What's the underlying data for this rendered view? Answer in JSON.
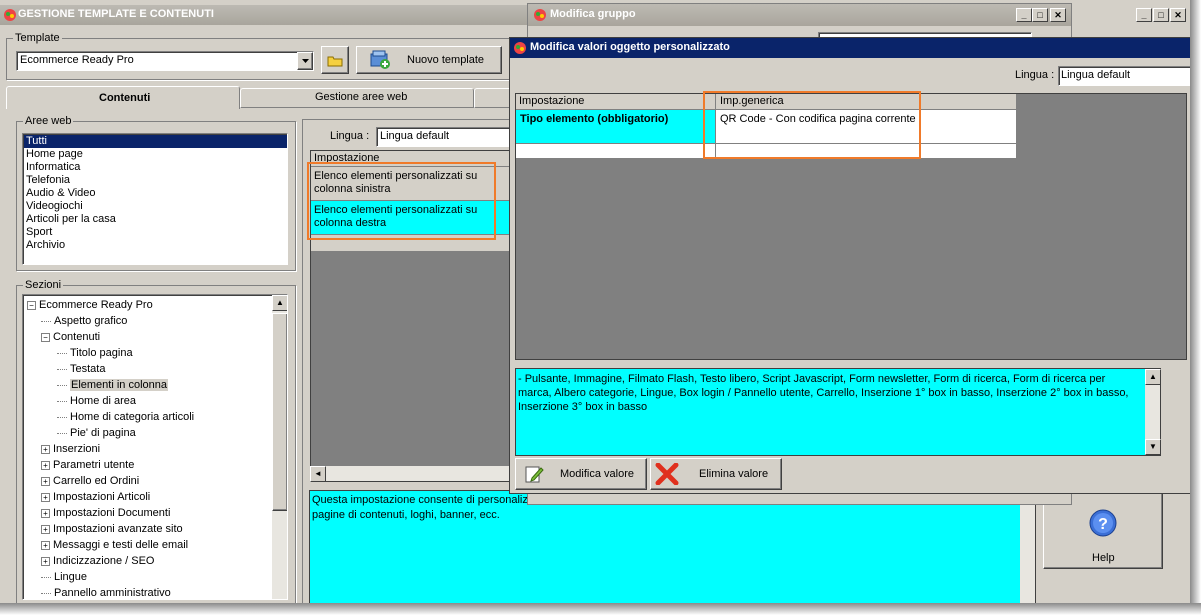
{
  "main_window": {
    "title": "GESTIONE TEMPLATE E CONTENUTI",
    "template_label": "Template",
    "template_value": "Ecommerce Ready Pro",
    "new_template_label": "Nuovo template",
    "tabs": [
      {
        "label": "Contenuti",
        "active": true
      },
      {
        "label": "Gestione aree web",
        "active": false
      }
    ],
    "aree_web_label": "Aree web",
    "aree_web": [
      "Tutti",
      "Home page",
      "Informatica",
      "Telefonia",
      "Audio & Video",
      "Videogiochi",
      "Articoli per la casa",
      "Sport",
      "Archivio"
    ],
    "sezioni_label": "Sezioni",
    "tree": [
      {
        "label": "Ecommerce Ready Pro",
        "level": 0,
        "toggle": "minus"
      },
      {
        "label": "Aspetto grafico",
        "level": 1,
        "toggle": ""
      },
      {
        "label": "Contenuti",
        "level": 1,
        "toggle": "minus"
      },
      {
        "label": "Titolo pagina",
        "level": 2,
        "toggle": ""
      },
      {
        "label": "Testata",
        "level": 2,
        "toggle": ""
      },
      {
        "label": "Elementi in colonna",
        "level": 2,
        "toggle": "",
        "selected": true
      },
      {
        "label": "Home di area",
        "level": 2,
        "toggle": ""
      },
      {
        "label": "Home di categoria articoli",
        "level": 2,
        "toggle": ""
      },
      {
        "label": "Pie' di pagina",
        "level": 2,
        "toggle": ""
      },
      {
        "label": "Inserzioni",
        "level": 1,
        "toggle": "plus"
      },
      {
        "label": "Parametri utente",
        "level": 1,
        "toggle": "plus"
      },
      {
        "label": "Carrello ed Ordini",
        "level": 1,
        "toggle": "plus"
      },
      {
        "label": "Impostazioni Articoli",
        "level": 1,
        "toggle": "plus"
      },
      {
        "label": "Impostazioni Documenti",
        "level": 1,
        "toggle": "plus"
      },
      {
        "label": "Impostazioni avanzate sito",
        "level": 1,
        "toggle": "plus"
      },
      {
        "label": "Messaggi e testi delle email",
        "level": 1,
        "toggle": "plus"
      },
      {
        "label": "Indicizzazione / SEO",
        "level": 1,
        "toggle": "plus"
      },
      {
        "label": "Lingue",
        "level": 1,
        "toggle": ""
      },
      {
        "label": "Pannello amministrativo",
        "level": 1,
        "toggle": ""
      }
    ],
    "lingua_label": "Lingua :",
    "lingua_value": "Lingua default",
    "grid_header": "Impostazione",
    "grid_rows": [
      {
        "text": "Elenco elementi personalizzati su colonna sinistra",
        "highlight": false
      },
      {
        "text": "Elenco elementi personalizzati su colonna destra",
        "highlight": true
      }
    ],
    "description_visible": "Questa impostazione consente di personaliz",
    "description_line2": "pagine di contenuti, loghi, banner, ecc.",
    "help_label": "Help"
  },
  "group_window": {
    "title": "Modifica gruppo"
  },
  "dialog": {
    "title": "Modifica valori oggetto personalizzato",
    "lingua_label": "Lingua :",
    "lingua_value": "Lingua default",
    "col_impostazione": "Impostazione",
    "col_imp_generica": "Imp.generica",
    "row_label": "Tipo elemento (obbligatorio)",
    "row_value": "QR Code - Con codifica pagina corrente",
    "info_text": "- Pulsante, Immagine, Filmato Flash, Testo libero, Script Javascript, Form newsletter, Form di ricerca, Form di ricerca per marca, Albero categorie, Lingue, Box login / Pannello utente, Carrello, Inserzione 1° box in basso, Inserzione 2° box in basso, Inserzione 3° box in basso",
    "modifica_label": "Modifica valore",
    "elimina_label": "Elimina valore"
  },
  "colors": {
    "cyan": "#00ffff",
    "orange": "#f07a2a",
    "dark_gray": "#808080",
    "selection": "#0a246a"
  }
}
